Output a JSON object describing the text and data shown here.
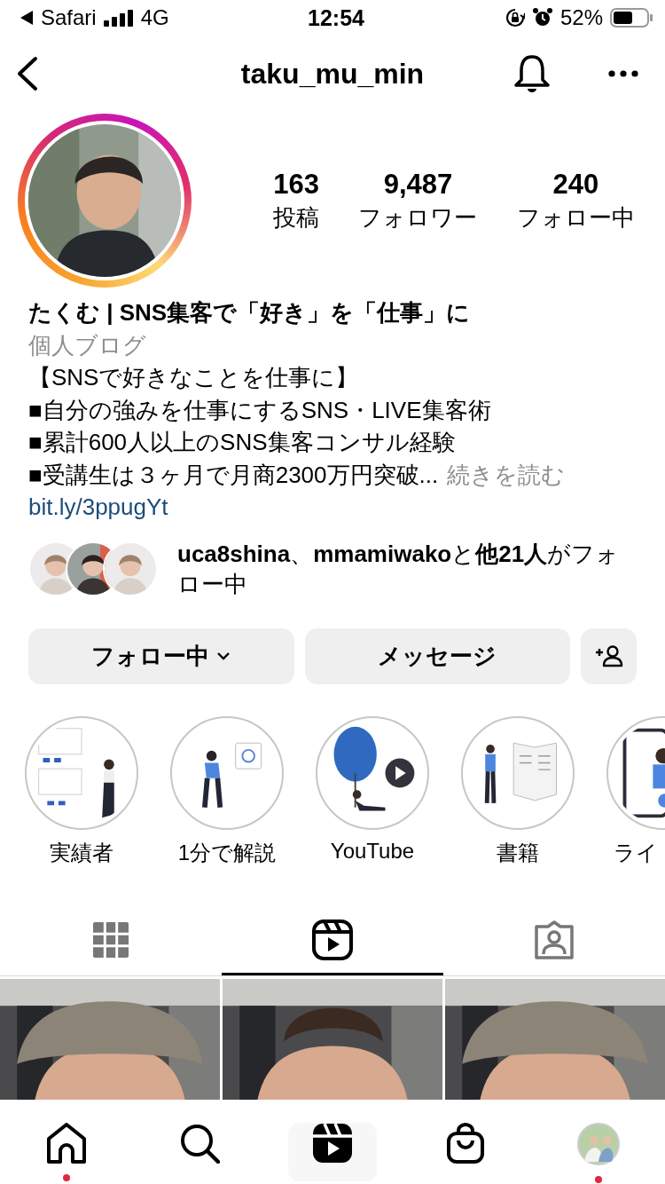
{
  "status_bar": {
    "back_app": "Safari",
    "network": "4G",
    "time": "12:54",
    "battery": "52%"
  },
  "header": {
    "username": "taku_mu_min"
  },
  "profile": {
    "stats": [
      {
        "value": "163",
        "label": "投稿"
      },
      {
        "value": "9,487",
        "label": "フォロワー"
      },
      {
        "value": "240",
        "label": "フォロー中"
      }
    ]
  },
  "bio": {
    "name": "たくむ | SNS集客で「好き」を「仕事」に",
    "category": "個人ブログ",
    "lines": [
      "【SNSで好きなことを仕事に】",
      "■自分の強みを仕事にするSNS・LIVE集客術",
      "■累計600人以上のSNS集客コンサル経験",
      "■受講生は３ヶ月で月商2300万円突破..."
    ],
    "more": "続きを読む",
    "link": "bit.ly/3ppugYt"
  },
  "followed_by": "**uca8shina**、**mmamiwako**と**他21人**がフォロー中",
  "buttons": [
    {
      "label": "フォロー中",
      "kind": "dropdown"
    },
    {
      "label": "メッセージ",
      "kind": "plain"
    }
  ],
  "highlights": [
    {
      "label": "実績者",
      "kind": "reviews"
    },
    {
      "label": "1分で解説",
      "kind": "mail"
    },
    {
      "label": "YouTube",
      "kind": "video"
    },
    {
      "label": "書籍",
      "kind": "book"
    },
    {
      "label": "ライ",
      "kind": "phone"
    }
  ],
  "tabs": [
    {
      "kind": "grid",
      "selected": false
    },
    {
      "kind": "reels",
      "selected": true
    },
    {
      "kind": "tagged",
      "selected": false
    }
  ],
  "nav": [
    {
      "kind": "home",
      "selected": false,
      "badge": true
    },
    {
      "kind": "search",
      "selected": false,
      "badge": false
    },
    {
      "kind": "reels",
      "selected": true,
      "badge": false
    },
    {
      "kind": "shop",
      "selected": false,
      "badge": false
    },
    {
      "kind": "profile",
      "selected": false,
      "badge": true
    }
  ]
}
